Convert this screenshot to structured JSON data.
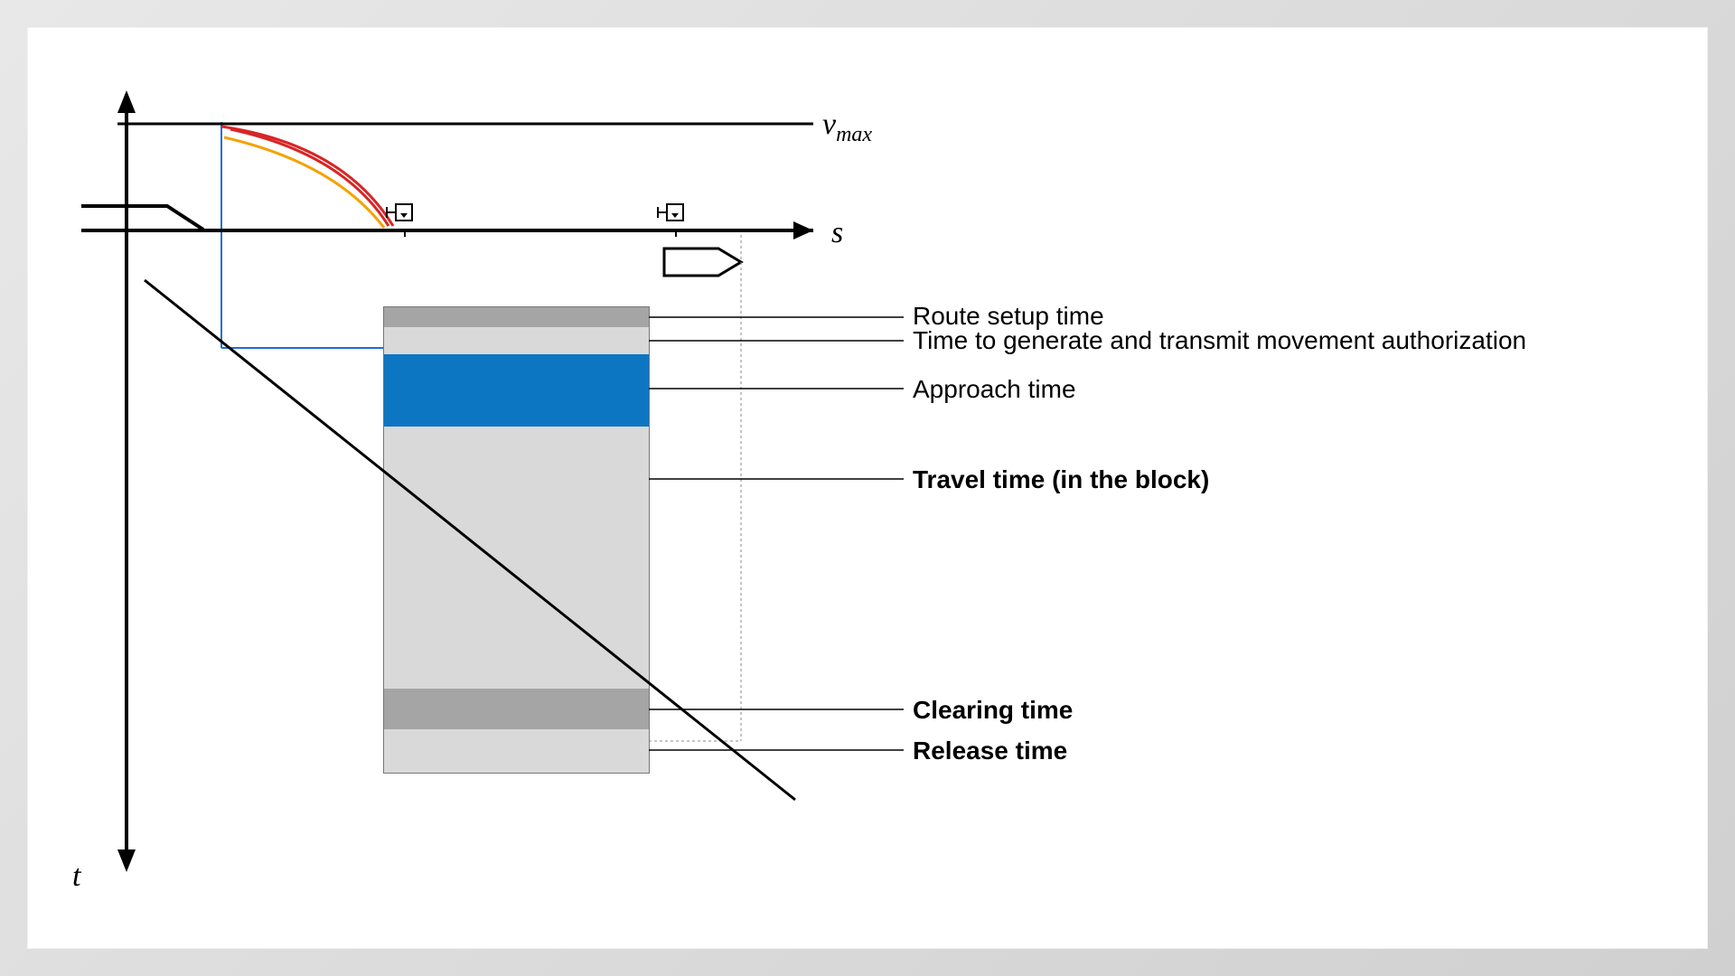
{
  "axes": {
    "t_label": "t",
    "s_label": "s",
    "vmax_label_v": "v",
    "vmax_label_sub": "max"
  },
  "bands": {
    "route_setup": "Route setup time",
    "movement_auth": "Time to generate and transmit movement authorization",
    "approach": "Approach time",
    "travel": "Travel time (in the block)",
    "clearing": "Clearing time",
    "release": "Release time"
  },
  "colors": {
    "approach": "#0d76c2",
    "band_dark": "#a5a5a5",
    "band_light": "#d9d9d9",
    "curve_red": "#d82525",
    "curve_orange": "#f5a200",
    "guide_blue": "#1f6fd1"
  },
  "chart_data": {
    "type": "diagram",
    "description": "Blocking-time stairway diagram: distance (s) horizontal vs. time (t) downward; upper sub-plot shows speed profile with v_max and braking curves to a signal; lower stacked bands decompose block occupancy time.",
    "axes": {
      "x": "s (distance)",
      "y_down": "t (time, increasing downward)",
      "y_upper": "v (speed)"
    },
    "speed_profile": {
      "v_max_line_y": 1.0,
      "braking_curves": [
        "red (supervision)",
        "orange (indication)"
      ],
      "signals_on_s_axis": 2,
      "stop_marker": true
    },
    "bands_order_top_to_bottom": [
      {
        "name": "Route setup time",
        "bold": false,
        "rel_thickness": 0.06
      },
      {
        "name": "Time to generate and transmit movement authorization",
        "bold": false,
        "rel_thickness": 0.09
      },
      {
        "name": "Approach time",
        "bold": false,
        "rel_thickness": 0.22,
        "highlight": true
      },
      {
        "name": "Travel time (in the block)",
        "bold": true,
        "rel_thickness": 0.4
      },
      {
        "name": "Clearing time",
        "bold": true,
        "rel_thickness": 0.1
      },
      {
        "name": "Release time",
        "bold": true,
        "rel_thickness": 0.13
      }
    ],
    "diagonal_train_path": {
      "from": "upper-left of band stack",
      "to": "lower-right past block"
    }
  }
}
